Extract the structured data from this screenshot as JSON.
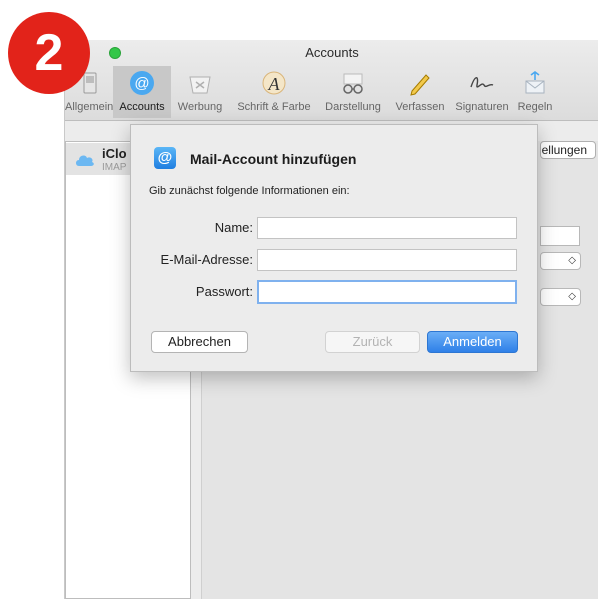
{
  "step_badge": "2",
  "window": {
    "title": "Accounts"
  },
  "toolbar": {
    "items": [
      {
        "label": "Allgemein",
        "icon": "switch-icon"
      },
      {
        "label": "Accounts",
        "icon": "at-icon"
      },
      {
        "label": "Werbung",
        "icon": "junk-mail-icon"
      },
      {
        "label": "Schrift & Farbe",
        "icon": "font-color-icon"
      },
      {
        "label": "Darstellung",
        "icon": "glasses-icon"
      },
      {
        "label": "Verfassen",
        "icon": "pencil-icon"
      },
      {
        "label": "Signaturen",
        "icon": "signature-icon"
      },
      {
        "label": "Regeln",
        "icon": "rules-envelope-icon"
      }
    ],
    "active": "Accounts"
  },
  "sidebar": {
    "account": {
      "name": "iClo",
      "type": "IMAP"
    }
  },
  "background": {
    "button_label": "ellungen",
    "stepper_glyph": "◇"
  },
  "dialog": {
    "title": "Mail-Account hinzufügen",
    "icon_glyph": "@",
    "subtitle": "Gib zunächst folgende Informationen ein:",
    "fields": [
      {
        "label": "Name:",
        "value": "",
        "placeholder": ""
      },
      {
        "label": "E-Mail-Adresse:",
        "value": "",
        "placeholder": ""
      },
      {
        "label": "Passwort:",
        "value": "",
        "placeholder": ""
      }
    ],
    "buttons": {
      "cancel": "Abbrechen",
      "back": "Zurück",
      "login": "Anmelden"
    }
  },
  "colors": {
    "badge": "#e2231a",
    "accent": "#2f80e8",
    "focus_ring": "#7fb1ee"
  }
}
